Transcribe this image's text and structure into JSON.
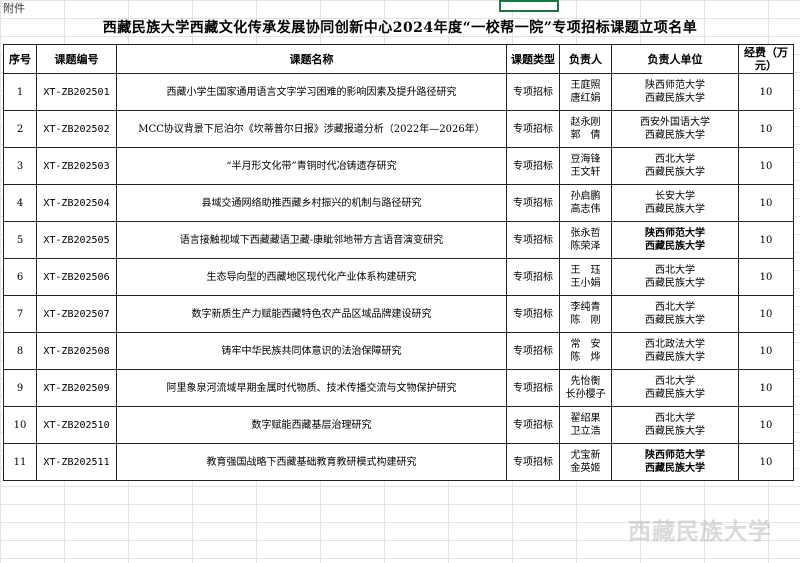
{
  "attachment_label": "附件",
  "title": "西藏民族大学西藏文化传承发展协同创新中心2024年度“一校帮一院”专项招标课题立项名单",
  "headers": {
    "no": "序号",
    "code": "课题编号",
    "name": "课题名称",
    "type": "课题类型",
    "lead": "负责人",
    "unit": "负责人单位",
    "fund": "经费（万元）"
  },
  "rows": [
    {
      "no": "1",
      "code": "XT-ZB202501",
      "name": "西藏小学生国家通用语言文字学习困难的影响因素及提升路径研究",
      "type": "专项招标",
      "lead": [
        "王庭照",
        "唐红娟"
      ],
      "unit": [
        "陕西师范大学",
        "西藏民族大学"
      ],
      "fund": "10"
    },
    {
      "no": "2",
      "code": "XT-ZB202502",
      "name": "MCC协议背景下尼泊尔《坎蒂普尔日报》涉藏报道分析（2022年—2026年）",
      "type": "专项招标",
      "lead": [
        "赵永刚",
        "郭　倩"
      ],
      "unit": [
        "西安外国语大学",
        "西藏民族大学"
      ],
      "fund": "10"
    },
    {
      "no": "3",
      "code": "XT-ZB202503",
      "name": "“半月形文化带”青铜时代冶铸遗存研究",
      "type": "专项招标",
      "lead": [
        "豆海锋",
        "王文轩"
      ],
      "unit": [
        "西北大学",
        "西藏民族大学"
      ],
      "fund": "10"
    },
    {
      "no": "4",
      "code": "XT-ZB202504",
      "name": "县域交通网络助推西藏乡村振兴的机制与路径研究",
      "type": "专项招标",
      "lead": [
        "孙启鹏",
        "高志伟"
      ],
      "unit": [
        "长安大学",
        "西藏民族大学"
      ],
      "fund": "10"
    },
    {
      "no": "5",
      "code": "XT-ZB202505",
      "name": "语言接触视域下西藏藏语卫藏-康眦邻地带方言语音演变研究",
      "type": "专项招标",
      "lead": [
        "张永哲",
        "陈荣泽"
      ],
      "unit": [
        "陕西师范大学",
        "西藏民族大学"
      ],
      "fund": "10"
    },
    {
      "no": "6",
      "code": "XT-ZB202506",
      "name": "生态导向型的西藏地区现代化产业体系构建研究",
      "type": "专项招标",
      "lead": [
        "王　珏",
        "王小娟"
      ],
      "unit": [
        "西北大学",
        "西藏民族大学"
      ],
      "fund": "10"
    },
    {
      "no": "7",
      "code": "XT-ZB202507",
      "name": "数字新质生产力赋能西藏特色农产品区域品牌建设研究",
      "type": "专项招标",
      "lead": [
        "李纯青",
        "陈　刚"
      ],
      "unit": [
        "西北大学",
        "西藏民族大学"
      ],
      "fund": "10"
    },
    {
      "no": "8",
      "code": "XT-ZB202508",
      "name": "铸牢中华民族共同体意识的法治保障研究",
      "type": "专项招标",
      "lead": [
        "常　安",
        "陈　烨"
      ],
      "unit": [
        "西北政法大学",
        "西藏民族大学"
      ],
      "fund": "10"
    },
    {
      "no": "9",
      "code": "XT-ZB202509",
      "name": "阿里象泉河流域早期金属时代物质、技术传播交流与文物保护研究",
      "type": "专项招标",
      "lead": [
        "先怡衡",
        "长孙樱子"
      ],
      "unit": [
        "西北大学",
        "西藏民族大学"
      ],
      "fund": "10"
    },
    {
      "no": "10",
      "code": "XT-ZB202510",
      "name": "数字赋能西藏基层治理研究",
      "type": "专项招标",
      "lead": [
        "翟绍果",
        "卫立浩"
      ],
      "unit": [
        "西北大学",
        "西藏民族大学"
      ],
      "fund": "10"
    },
    {
      "no": "11",
      "code": "XT-ZB202511",
      "name": "教育强国战略下西藏基础教育教研模式构建研究",
      "type": "专项招标",
      "lead": [
        "尤宝新",
        "金英姬"
      ],
      "unit": [
        "陕西师范大学",
        "西藏民族大学"
      ],
      "fund": "10"
    }
  ],
  "watermark": "西藏民族大学"
}
